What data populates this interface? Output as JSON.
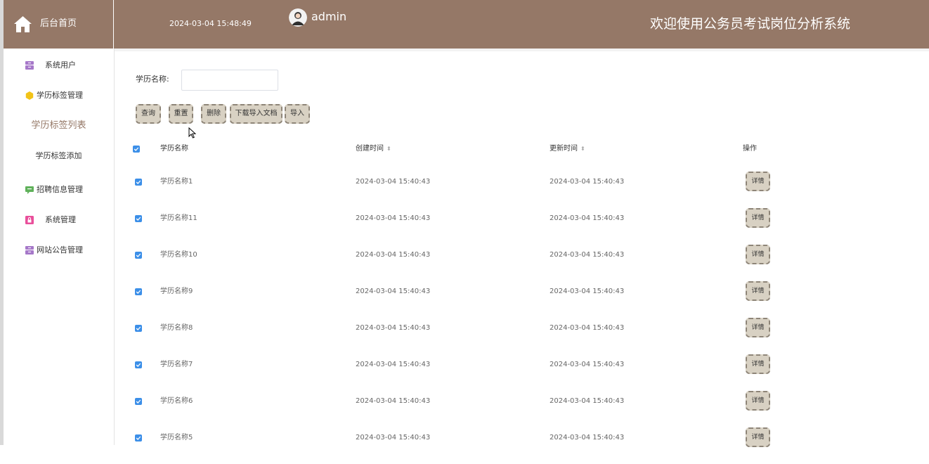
{
  "header": {
    "home_label": "后台首页",
    "datetime": "2024-03-04 15:48:49",
    "username": "admin",
    "site_title": "欢迎使用公务员考试岗位分析系统"
  },
  "sidebar": {
    "items": [
      {
        "label": "系统用户",
        "icon": "archive-icon",
        "color": "#a678c9"
      },
      {
        "label": "学历标签管理",
        "icon": "hexagon-icon",
        "color": "#f2c318"
      },
      {
        "label": "招聘信息管理",
        "icon": "chat-icon",
        "color": "#5fb15a"
      },
      {
        "label": "系统管理",
        "icon": "lock-icon",
        "color": "#e94f9b"
      },
      {
        "label": "网站公告管理",
        "icon": "archive-icon",
        "color": "#a678c9"
      }
    ],
    "submenu": [
      {
        "label": "学历标签列表",
        "active": true
      },
      {
        "label": "学历标签添加",
        "active": false
      }
    ]
  },
  "search": {
    "label": "学历名称:",
    "value": "",
    "placeholder": ""
  },
  "buttons": {
    "query": "查询",
    "reset": "重置",
    "delete": "删除",
    "download_template": "下载导入文档",
    "import": "导入"
  },
  "table": {
    "headers": {
      "name": "学历名称",
      "created": "创建时间",
      "updated": "更新时间",
      "actions": "操作"
    },
    "detail_label": "详情",
    "rows": [
      {
        "name": "学历名称1",
        "created": "2024-03-04 15:40:43",
        "updated": "2024-03-04 15:40:43"
      },
      {
        "name": "学历名称11",
        "created": "2024-03-04 15:40:43",
        "updated": "2024-03-04 15:40:43"
      },
      {
        "name": "学历名称10",
        "created": "2024-03-04 15:40:43",
        "updated": "2024-03-04 15:40:43"
      },
      {
        "name": "学历名称9",
        "created": "2024-03-04 15:40:43",
        "updated": "2024-03-04 15:40:43"
      },
      {
        "name": "学历名称8",
        "created": "2024-03-04 15:40:43",
        "updated": "2024-03-04 15:40:43"
      },
      {
        "name": "学历名称7",
        "created": "2024-03-04 15:40:43",
        "updated": "2024-03-04 15:40:43"
      },
      {
        "name": "学历名称6",
        "created": "2024-03-04 15:40:43",
        "updated": "2024-03-04 15:40:43"
      },
      {
        "name": "学历名称5",
        "created": "2024-03-04 15:40:43",
        "updated": "2024-03-04 15:40:43"
      }
    ]
  },
  "colors": {
    "header_bg": "#957867",
    "accent": "#957867",
    "button_bg": "#d8d1c3",
    "button_border": "#8e8578",
    "checkbox": "#3c8fe8"
  }
}
